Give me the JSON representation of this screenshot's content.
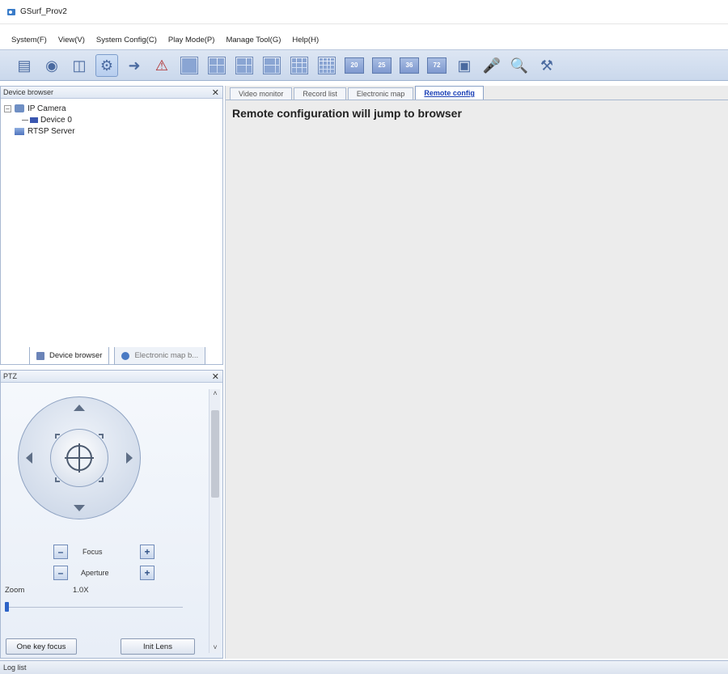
{
  "window": {
    "title": "GSurf_Prov2"
  },
  "menu": [
    {
      "label": "System(F)"
    },
    {
      "label": "View(V)"
    },
    {
      "label": "System Config(C)"
    },
    {
      "label": "Play Mode(P)"
    },
    {
      "label": "Manage Tool(G)"
    },
    {
      "label": "Help(H)"
    }
  ],
  "toolbar": {
    "layout_numbers": [
      "20",
      "25",
      "36",
      "72"
    ],
    "icons": [
      "device-browser-icon",
      "electronic-map-icon",
      "record-icon",
      "remote-config-icon",
      "export-icon",
      "alarm-icon",
      "layout-1-icon",
      "layout-4-icon",
      "layout-6-icon",
      "layout-8-icon",
      "layout-9-icon",
      "layout-16-icon",
      "layout-20-icon",
      "layout-25-icon",
      "layout-36-icon",
      "layout-72-icon",
      "fullscreen-icon",
      "talk-icon",
      "search-icon",
      "tools-icon"
    ]
  },
  "device_panel": {
    "title": "Device browser",
    "tree": {
      "camera_group": "IP Camera",
      "device": "Device 0",
      "server": "RTSP Server"
    },
    "tabs": [
      {
        "label": "Device browser"
      },
      {
        "label": "Electronic map b..."
      }
    ]
  },
  "ptz": {
    "title": "PTZ",
    "focus_label": "Focus",
    "aperture_label": "Aperture",
    "zoom_label": "Zoom",
    "zoom_value": "1.0X",
    "one_key_focus": "One key focus",
    "init_lens": "Init Lens"
  },
  "main": {
    "tabs": [
      {
        "label": "Video monitor"
      },
      {
        "label": "Record list"
      },
      {
        "label": "Electronic map"
      },
      {
        "label": "Remote config"
      }
    ],
    "active_tab": "Remote config",
    "message": "Remote configuration will jump to browser"
  },
  "status": {
    "label": "Log list"
  },
  "colors": {
    "toolbar_bg": "#cad8ec",
    "active_tab_text": "#1a3fb6",
    "panel_border": "#a9b9d2"
  }
}
